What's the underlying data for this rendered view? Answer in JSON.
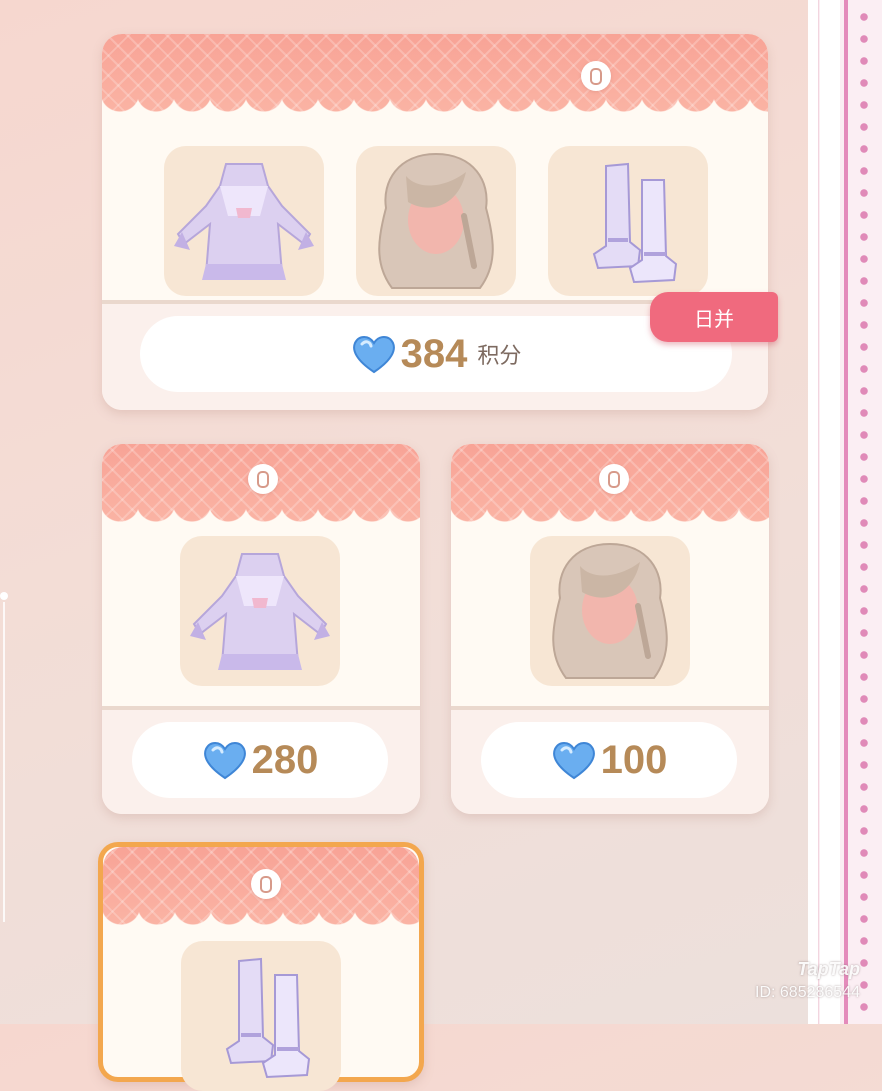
{
  "cards": [
    {
      "badge": "0",
      "price": "384",
      "unit": "积分",
      "tag": "日并",
      "items": [
        "dress-icon",
        "hair-icon",
        "boots-icon"
      ]
    },
    {
      "badge": "0",
      "price": "280",
      "items": [
        "dress-icon"
      ]
    },
    {
      "badge": "0",
      "price": "100",
      "items": [
        "hair-icon"
      ]
    },
    {
      "badge": "0",
      "items": [
        "boots-icon"
      ]
    }
  ],
  "watermark": {
    "logo": "TapTap",
    "id": "ID: 685286544"
  },
  "colors": {
    "accent": "#f06a7e",
    "price": "#b68a58",
    "header": "#f8a396"
  }
}
